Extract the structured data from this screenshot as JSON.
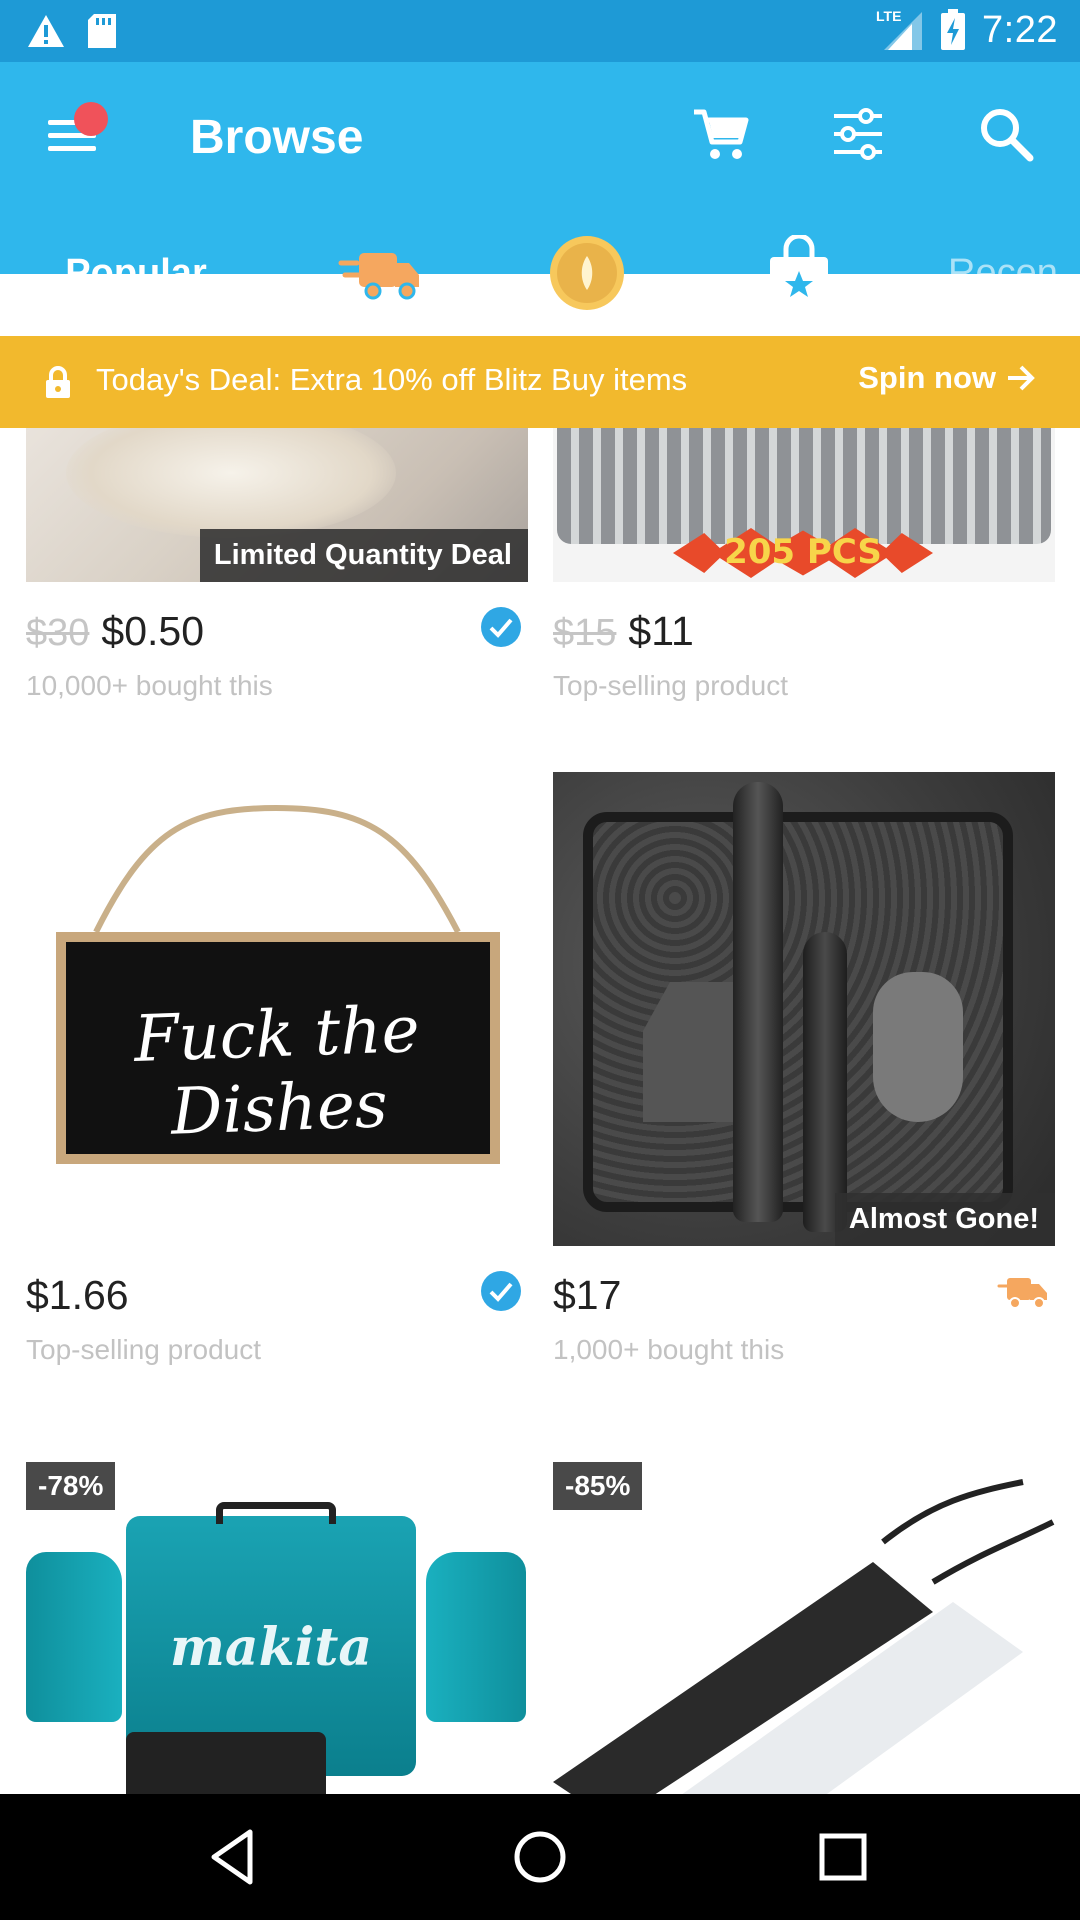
{
  "status_bar": {
    "time": "7:22",
    "network": "LTE"
  },
  "app_bar": {
    "title": "Browse"
  },
  "tabs": [
    {
      "label": "Popular",
      "selected": true
    },
    {
      "icon": "delivery-truck-icon"
    },
    {
      "icon": "gold-coin-icon"
    },
    {
      "icon": "shopping-bag-star-icon"
    },
    {
      "label": "Recen"
    }
  ],
  "deal_banner": {
    "text": "Today's Deal: Extra 10% off Blitz Buy items",
    "action": "Spin now"
  },
  "products": [
    {
      "badge": "Limited Quantity Deal",
      "old_price": "$30",
      "price": "$0.50",
      "subtitle": "10,000+ bought this",
      "tag_icon": "verified-check-icon"
    },
    {
      "image_text": "205 PCS",
      "old_price": "$15",
      "price": "$11",
      "subtitle": "Top-selling product"
    },
    {
      "sign_text": "Fuck the Dishes",
      "price": "$1.66",
      "subtitle": "Top-selling product",
      "tag_icon": "verified-check-icon"
    },
    {
      "badge": "Almost Gone!",
      "price": "$17",
      "subtitle": "1,000+ bought this",
      "tag_icon": "delivery-truck-icon"
    },
    {
      "discount": "-78%",
      "brand_text": "makita"
    },
    {
      "discount": "-85%"
    }
  ],
  "colors": {
    "status_bar": "#1e9ad6",
    "app_bar": "#2fb7ec",
    "banner": "#f2b92d",
    "verified": "#2fa7e4",
    "truck": "#f5a75f"
  }
}
